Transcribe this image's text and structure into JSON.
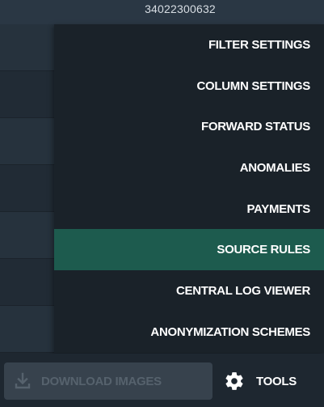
{
  "header": {
    "id_text": "34022300632"
  },
  "menu": {
    "items": [
      {
        "label": "FILTER SETTINGS"
      },
      {
        "label": "COLUMN SETTINGS"
      },
      {
        "label": "FORWARD STATUS"
      },
      {
        "label": "ANOMALIES"
      },
      {
        "label": "PAYMENTS"
      },
      {
        "label": "SOURCE RULES"
      },
      {
        "label": "CENTRAL LOG VIEWER"
      },
      {
        "label": "ANONYMIZATION SCHEMES"
      }
    ],
    "active_item": "SOURCE RULES"
  },
  "bottom_bar": {
    "download_label": "DOWNLOAD IMAGES",
    "download_icon": "download-icon",
    "tools_label": "TOOLS",
    "tools_icon": "gear-icon"
  },
  "colors": {
    "active_highlight": "#1d5b4e",
    "menu_background": "#1a2229",
    "disabled_button": "#37424d"
  }
}
